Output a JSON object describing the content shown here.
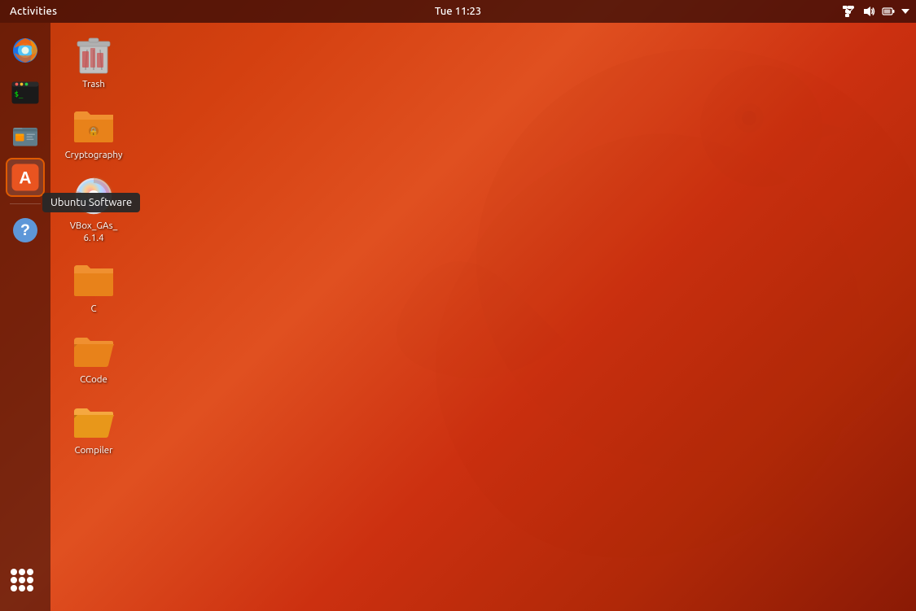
{
  "topbar": {
    "activities_label": "Activities",
    "clock": "Tue 11:23"
  },
  "dock": {
    "items": [
      {
        "id": "firefox",
        "label": "Firefox"
      },
      {
        "id": "terminal",
        "label": "Terminal"
      },
      {
        "id": "files",
        "label": "Files"
      },
      {
        "id": "ubuntu-software",
        "label": "Ubuntu Software",
        "active": true
      }
    ],
    "help_label": "Help",
    "apps_grid_label": "Show Applications"
  },
  "tooltip": {
    "text": "Ubuntu Software"
  },
  "desktop": {
    "icons": [
      {
        "id": "trash",
        "label": "Trash",
        "type": "trash"
      },
      {
        "id": "cryptography",
        "label": "Cryptography",
        "type": "folder-orange"
      },
      {
        "id": "vbox-gas",
        "label": "VBox_GAs_\n6.1.4",
        "type": "cd",
        "label_lines": [
          "VBox_GAs_",
          "6.1.4"
        ]
      },
      {
        "id": "folder-c",
        "label": "C",
        "type": "folder-orange"
      },
      {
        "id": "ccode",
        "label": "CCode",
        "type": "folder-orange-open"
      },
      {
        "id": "compiler",
        "label": "Compiler",
        "type": "folder-orange-open2"
      }
    ]
  }
}
